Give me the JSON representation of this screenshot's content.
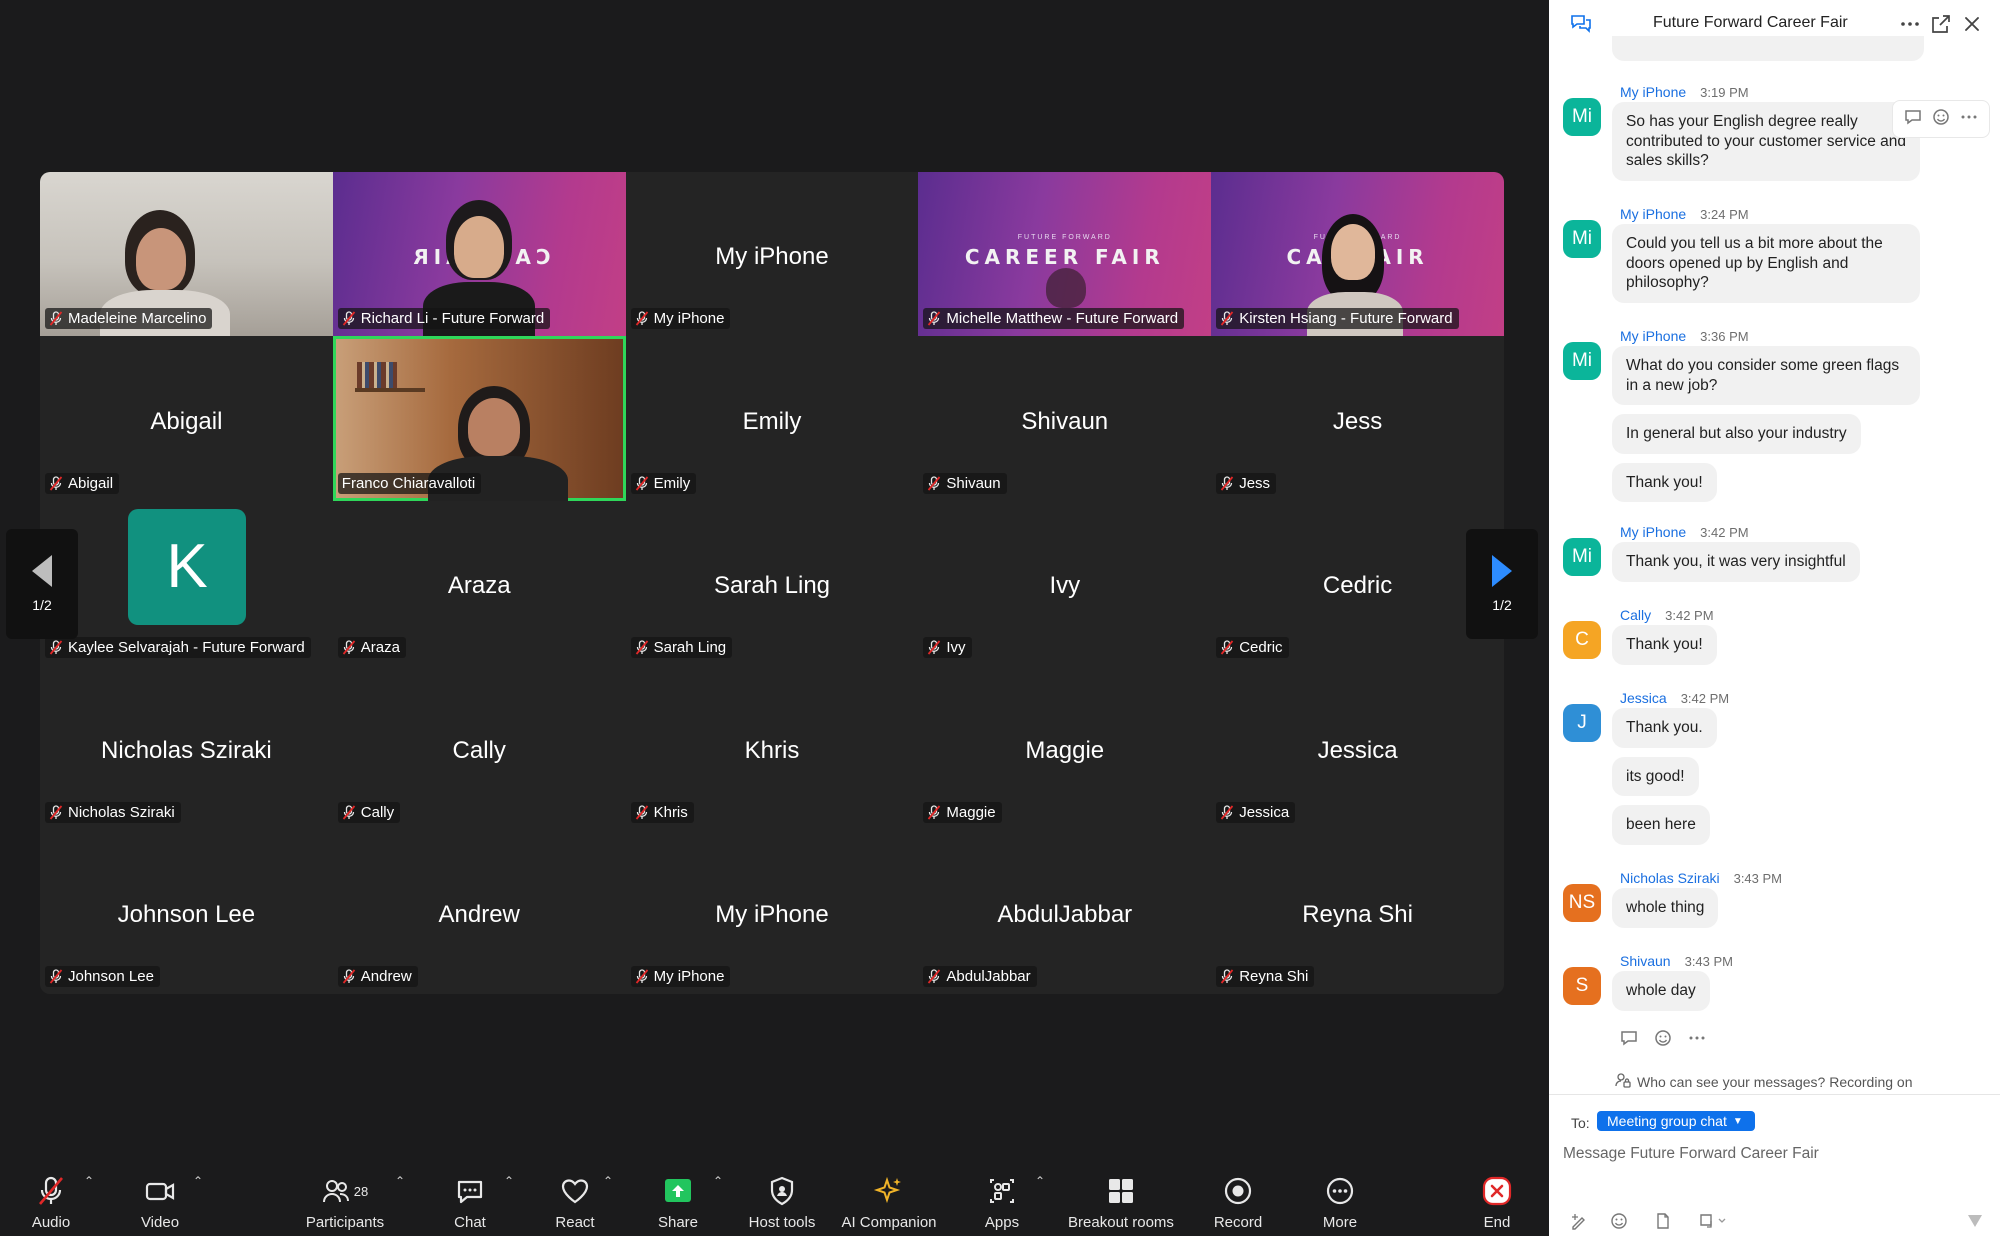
{
  "pager": {
    "page_label": "1/2"
  },
  "tiles": [
    {
      "name": "Madeleine Marcelino",
      "big": "",
      "type": "video-room"
    },
    {
      "name": "Richard Li - Future Forward",
      "big": "",
      "type": "video-banner-mirrored",
      "banner": "CAR    FAIR"
    },
    {
      "name": "My iPhone",
      "big": "My iPhone",
      "type": "name"
    },
    {
      "name": "Michelle Matthew - Future Forward",
      "big": "",
      "type": "video-banner",
      "banner": "CAREER FAIR",
      "banner_sub": "FUTURE FORWARD"
    },
    {
      "name": "Kirsten Hsiang - Future Forward",
      "big": "",
      "type": "video-banner",
      "banner": "CAR        FAIR",
      "banner_sub": "FUTURE  ORWARD"
    },
    {
      "name": "Abigail",
      "big": "Abigail",
      "type": "name"
    },
    {
      "name": "Franco Chiaravalloti",
      "big": "",
      "type": "video-franco"
    },
    {
      "name": "Emily",
      "big": "Emily",
      "type": "name"
    },
    {
      "name": "Shivaun",
      "big": "Shivaun",
      "type": "name"
    },
    {
      "name": "Jess",
      "big": "Jess",
      "type": "name"
    },
    {
      "name": "Kaylee Selvarajah - Future Forward",
      "big": "",
      "type": "avatar",
      "avatar_letter": "K",
      "avatar_color": "#11917f"
    },
    {
      "name": "Araza",
      "big": "Araza",
      "type": "name"
    },
    {
      "name": "Sarah Ling",
      "big": "Sarah Ling",
      "type": "name"
    },
    {
      "name": "Ivy",
      "big": "Ivy",
      "type": "name"
    },
    {
      "name": "Cedric",
      "big": "Cedric",
      "type": "name"
    },
    {
      "name": "Nicholas Sziraki",
      "big": "Nicholas Sziraki",
      "type": "name"
    },
    {
      "name": "Cally",
      "big": "Cally",
      "type": "name"
    },
    {
      "name": "Khris",
      "big": "Khris",
      "type": "name"
    },
    {
      "name": "Maggie",
      "big": "Maggie",
      "type": "name"
    },
    {
      "name": "Jessica",
      "big": "Jessica",
      "type": "name"
    },
    {
      "name": "Johnson Lee",
      "big": "Johnson Lee",
      "type": "name"
    },
    {
      "name": "Andrew",
      "big": "Andrew",
      "type": "name"
    },
    {
      "name": "My iPhone",
      "big": "My iPhone",
      "type": "name"
    },
    {
      "name": "AbdulJabbar",
      "big": "AbdulJabbar",
      "type": "name"
    },
    {
      "name": "Reyna Shi",
      "big": "Reyna Shi",
      "type": "name"
    }
  ],
  "toolbar": {
    "audio": "Audio",
    "video": "Video",
    "participants": "Participants",
    "participants_count": "28",
    "chat": "Chat",
    "react": "React",
    "share": "Share",
    "host_tools": "Host tools",
    "ai_companion": "AI Companion",
    "apps": "Apps",
    "breakout_rooms": "Breakout rooms",
    "record": "Record",
    "more": "More",
    "end": "End"
  },
  "chat": {
    "title": "Future Forward Career Fair",
    "messages": [
      {
        "sender": "My iPhone",
        "time": "3:19 PM",
        "initials": "Mi",
        "color": "#0bb59a",
        "lines": [
          "So has your English degree really contributed to your customer service and sales skills?"
        ]
      },
      {
        "sender": "My iPhone",
        "time": "3:24 PM",
        "initials": "Mi",
        "color": "#0bb59a",
        "lines": [
          "Could you tell us a bit more about the doors opened up by English and philosophy?"
        ]
      },
      {
        "sender": "My iPhone",
        "time": "3:36 PM",
        "initials": "Mi",
        "color": "#0bb59a",
        "lines": [
          "What do you consider some green flags in a new job?",
          "In general but also your industry",
          "Thank you!"
        ]
      },
      {
        "sender": "My iPhone",
        "time": "3:42 PM",
        "initials": "Mi",
        "color": "#0bb59a",
        "lines": [
          "Thank you, it was very insightful"
        ]
      },
      {
        "sender": "Cally",
        "time": "3:42 PM",
        "initials": "C",
        "color": "#f5a524",
        "lines": [
          "Thank you!"
        ]
      },
      {
        "sender": "Jessica",
        "time": "3:42 PM",
        "initials": "J",
        "color": "#2f8fd6",
        "lines": [
          "Thank you.",
          "its good!",
          "been here"
        ]
      },
      {
        "sender": "Nicholas Sziraki",
        "time": "3:43 PM",
        "initials": "NS",
        "color": "#e5701f",
        "lines": [
          "whole thing"
        ]
      },
      {
        "sender": "Shivaun",
        "time": "3:43 PM",
        "initials": "S",
        "color": "#e5701f",
        "lines": [
          "whole day"
        ]
      }
    ],
    "notice": "Who can see your messages? Recording on",
    "to_label": "To:",
    "to_value": "Meeting group chat",
    "input_placeholder": "Message Future Forward Career Fair"
  },
  "colors": {
    "active_speaker": "#2fd75a",
    "accent": "#0e71eb",
    "share_green": "#22c55e",
    "end_red": "#e02828",
    "ai_gold": "#f0b429"
  }
}
